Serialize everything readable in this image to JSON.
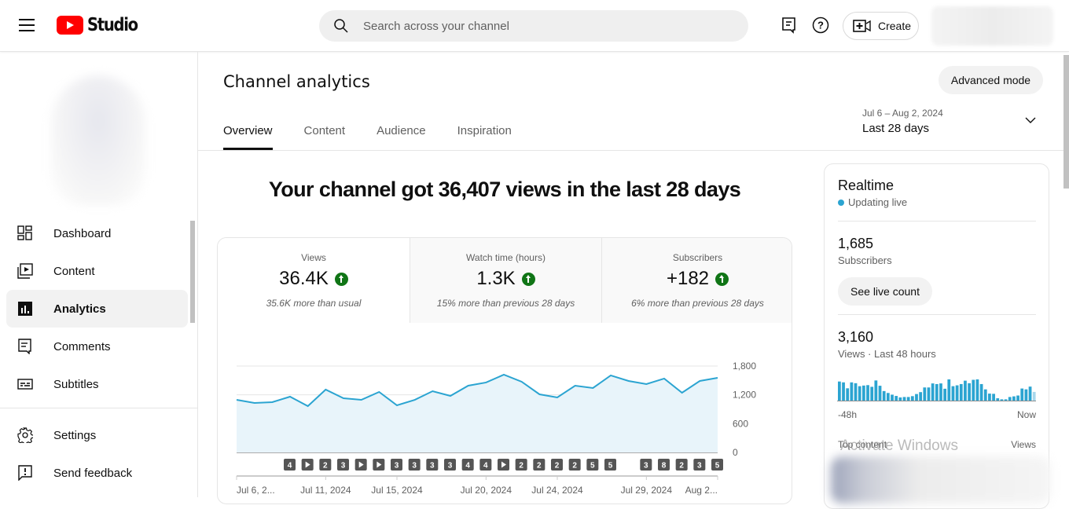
{
  "topbar": {
    "logo_text": "Studio",
    "search_placeholder": "Search across your channel",
    "create_label": "Create"
  },
  "sidebar": {
    "items": [
      {
        "label": "Dashboard",
        "icon": "dashboard-icon"
      },
      {
        "label": "Content",
        "icon": "content-icon"
      },
      {
        "label": "Analytics",
        "icon": "analytics-icon",
        "active": true
      },
      {
        "label": "Comments",
        "icon": "comments-icon"
      },
      {
        "label": "Subtitles",
        "icon": "subtitles-icon"
      }
    ],
    "bottom_items": [
      {
        "label": "Settings",
        "icon": "gear-icon"
      },
      {
        "label": "Send feedback",
        "icon": "feedback-icon"
      }
    ]
  },
  "page": {
    "title": "Channel analytics",
    "advanced_mode_label": "Advanced mode",
    "tabs": [
      "Overview",
      "Content",
      "Audience",
      "Inspiration"
    ],
    "active_tab": "Overview",
    "date_range": {
      "dates": "Jul 6 – Aug 2, 2024",
      "label": "Last 28 days"
    },
    "headline": "Your channel got 36,407 views in the last 28 days"
  },
  "metrics": [
    {
      "label": "Views",
      "value": "36.4K",
      "trend": "up",
      "sub": "35.6K more than usual"
    },
    {
      "label": "Watch time (hours)",
      "value": "1.3K",
      "trend": "up",
      "sub": "15% more than previous 28 days"
    },
    {
      "label": "Subscribers",
      "value": "+182",
      "trend": "up",
      "sub": "6% more than previous 28 days"
    }
  ],
  "chart_data": {
    "type": "area",
    "title": "Views",
    "x": [
      "Jul 6",
      "Jul 7",
      "Jul 8",
      "Jul 9",
      "Jul 10",
      "Jul 11",
      "Jul 12",
      "Jul 13",
      "Jul 14",
      "Jul 15",
      "Jul 16",
      "Jul 17",
      "Jul 18",
      "Jul 19",
      "Jul 20",
      "Jul 21",
      "Jul 22",
      "Jul 23",
      "Jul 24",
      "Jul 25",
      "Jul 26",
      "Jul 27",
      "Jul 28",
      "Jul 29",
      "Jul 30",
      "Jul 31",
      "Aug 1",
      "Aug 2"
    ],
    "values": [
      1096,
      1031,
      1047,
      1162,
      965,
      1309,
      1129,
      1096,
      1260,
      982,
      1096,
      1276,
      1178,
      1391,
      1457,
      1620,
      1473,
      1211,
      1146,
      1391,
      1342,
      1604,
      1489,
      1424,
      1539,
      1244,
      1489,
      1555
    ],
    "ylim": [
      0,
      1800
    ],
    "yticks": [
      "0",
      "600",
      "1,200",
      "1,800"
    ],
    "xtick_labels": [
      {
        "index": 0,
        "label": "Jul 6, 2..."
      },
      {
        "index": 5,
        "label": "Jul 11, 2024"
      },
      {
        "index": 9,
        "label": "Jul 15, 2024"
      },
      {
        "index": 14,
        "label": "Jul 20, 2024"
      },
      {
        "index": 18,
        "label": "Jul 24, 2024"
      },
      {
        "index": 23,
        "label": "Jul 29, 2024"
      },
      {
        "index": 27,
        "label": "Aug 2..."
      }
    ],
    "upload_markers": [
      {
        "index": 3,
        "label": "4"
      },
      {
        "index": 4,
        "label": "▶"
      },
      {
        "index": 5,
        "label": "2"
      },
      {
        "index": 6,
        "label": "3"
      },
      {
        "index": 7,
        "label": "▶"
      },
      {
        "index": 8,
        "label": "▶"
      },
      {
        "index": 9,
        "label": "3"
      },
      {
        "index": 10,
        "label": "3"
      },
      {
        "index": 11,
        "label": "3"
      },
      {
        "index": 12,
        "label": "3"
      },
      {
        "index": 13,
        "label": "4"
      },
      {
        "index": 14,
        "label": "4"
      },
      {
        "index": 15,
        "label": "▶"
      },
      {
        "index": 16,
        "label": "2"
      },
      {
        "index": 17,
        "label": "2"
      },
      {
        "index": 18,
        "label": "2"
      },
      {
        "index": 19,
        "label": "2"
      },
      {
        "index": 20,
        "label": "5"
      },
      {
        "index": 21,
        "label": "5"
      },
      {
        "index": 23,
        "label": "3"
      },
      {
        "index": 24,
        "label": "8"
      },
      {
        "index": 25,
        "label": "2"
      },
      {
        "index": 26,
        "label": "3"
      },
      {
        "index": 27,
        "label": "5"
      }
    ],
    "grid": true,
    "line_color": "#2ba4d1",
    "fill_color": "#e8f4fa"
  },
  "realtime": {
    "title": "Realtime",
    "status": "Updating live",
    "subscribers_value": "1,685",
    "subscribers_label": "Subscribers",
    "live_count_label": "See live count",
    "views_value": "3,160",
    "views_label": "Views · Last 48 hours",
    "axis_start": "-48h",
    "axis_end": "Now",
    "top_content_label": "Top content",
    "views_column_label": "Views",
    "bar_values": [
      90,
      86,
      58,
      86,
      82,
      68,
      71,
      73,
      65,
      95,
      70,
      45,
      36,
      28,
      22,
      15,
      17,
      17,
      21,
      31,
      40,
      62,
      62,
      81,
      78,
      81,
      56,
      100,
      68,
      72,
      78,
      94,
      82,
      98,
      100,
      78,
      53,
      33,
      32,
      11,
      6,
      6,
      17,
      20,
      24,
      57,
      53,
      66,
      41
    ],
    "bar_color": "#2ba4d1"
  },
  "watermark": "Activate Windows"
}
